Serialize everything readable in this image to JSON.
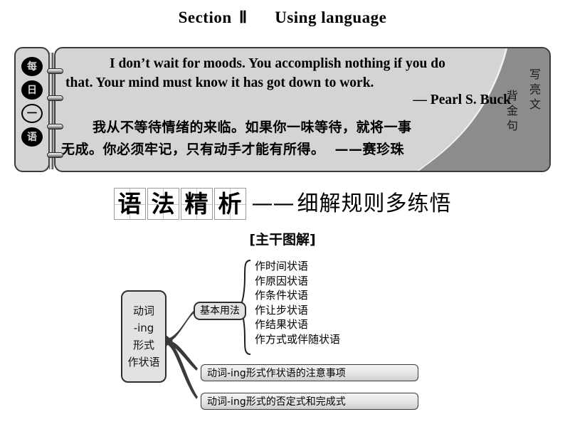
{
  "header": {
    "section_word": "Section",
    "section_number": "Ⅱ",
    "title": "Using language"
  },
  "quote_panel": {
    "binder_chars": [
      "每",
      "日",
      "一",
      "语"
    ],
    "english_line1": "I don’t wait for moods. You accomplish nothing if you do",
    "english_line2": "that. Your mind must know it has got down to work.",
    "attribution": "— Pearl S. Buck",
    "chinese_line1": "我从不等待情绪的来临。如果你一味等待，就将一事",
    "chinese_line2": "无成。你必须牢记，只有动手才能有所得。",
    "chinese_attr": "——赛珍珠",
    "side_label_outer": "写亮文",
    "side_label_inner": "背金句"
  },
  "grammar_heading": {
    "boxed_chars": [
      "语",
      "法",
      "精",
      "析"
    ],
    "dash": "——",
    "subtitle": "细解规则多练悟"
  },
  "diagram": {
    "label": "[主干图解]",
    "root_lines": [
      "动词",
      "-ing",
      "形式",
      "作状语"
    ],
    "branch_label": "基本用法",
    "leaves": [
      "作时间状语",
      "作原因状语",
      "作条件状语",
      "作让步状语",
      "作结果状语",
      "作方式或伴随状语"
    ],
    "bar1": "动词-ing形式作状语的注意事项",
    "bar2": "动词-ing形式的否定式和完成式"
  },
  "colors": {
    "panel_light": "#d4d4d4",
    "panel_dark": "#8c8c8c",
    "node_fill": "#e2e2e2",
    "outline": "#2e2e2e"
  }
}
